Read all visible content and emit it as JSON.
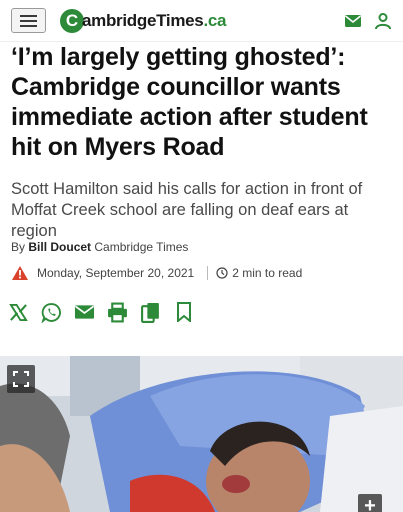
{
  "header": {
    "logo_letter": "C",
    "logo_name": "ambridgeTimes",
    "logo_suffix": ".ca",
    "brand_color": "#2c8a39",
    "icons": [
      "menu-icon",
      "mail-icon",
      "user-icon"
    ]
  },
  "article": {
    "headline": "‘I’m largely getting ghosted’: Cambridge councillor wants immediate action after student hit on Myers Road",
    "subhead": "Scott Hamilton said his calls for action in front of Moffat Creek school are falling on deaf ears at region",
    "byline_prefix": "By",
    "author": "Bill Doucet",
    "publication": "Cambridge Times",
    "date": "Monday, September 20, 2021",
    "read_time": "2 min to read",
    "alert_color": "#d9412b"
  },
  "share": {
    "icons": [
      "x-icon",
      "whatsapp-icon",
      "email-icon",
      "print-icon",
      "copy-icon",
      "bookmark-icon"
    ]
  },
  "photo": {
    "expand_icon": "expand-icon",
    "plus_label": "+"
  }
}
